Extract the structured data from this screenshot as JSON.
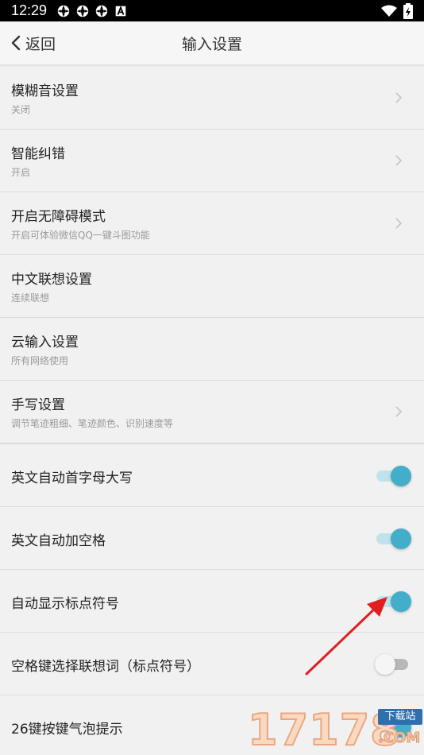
{
  "status_bar": {
    "time": "12:29",
    "left_icons": [
      "notification-icon",
      "notification-icon",
      "notification-icon",
      "a-icon"
    ],
    "right_icons": [
      "wifi-icon",
      "battery-icon"
    ]
  },
  "header": {
    "back_label": "返回",
    "title": "输入设置"
  },
  "settings": [
    {
      "title": "模糊音设置",
      "subtitle": "关闭",
      "control": "chevron"
    },
    {
      "title": "智能纠错",
      "subtitle": "开启",
      "control": "chevron"
    },
    {
      "title": "开启无障碍模式",
      "subtitle": "开启可体验微信QQ一键斗图功能",
      "control": "chevron"
    },
    {
      "title": "中文联想设置",
      "subtitle": "连续联想",
      "control": "none"
    },
    {
      "title": "云输入设置",
      "subtitle": "所有网络使用",
      "control": "none"
    },
    {
      "title": "手写设置",
      "subtitle": "调节笔迹粗细、笔迹颜色、识别速度等",
      "control": "chevron"
    },
    {
      "title": "英文自动首字母大写",
      "control": "toggle",
      "on": true
    },
    {
      "title": "英文自动加空格",
      "control": "toggle",
      "on": true
    },
    {
      "title": "自动显示标点符号",
      "control": "toggle",
      "on": true
    },
    {
      "title": "空格键选择联想词（标点符号）",
      "control": "toggle",
      "on": false
    },
    {
      "title": "26键按键气泡提示",
      "control": "toggle",
      "on": true
    }
  ],
  "watermark": {
    "digits": "17178",
    "badge": "下载站",
    "domain": ".COM"
  },
  "colors": {
    "accent": "#42aec9",
    "accent_track": "#bfe3ec",
    "annotation_arrow": "#e02020"
  }
}
